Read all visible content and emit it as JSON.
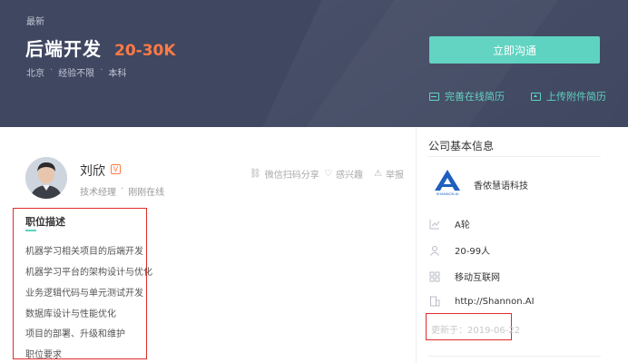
{
  "header": {
    "tag": "最新",
    "job_title": "后端开发",
    "salary": "20-30K",
    "meta": [
      "北京",
      "经验不限",
      "本科"
    ],
    "meta_sep": "·",
    "contact_button": "立即沟通",
    "online_resume": "完善在线简历",
    "upload_resume": "上传附件简历"
  },
  "recruiter": {
    "name": "刘欣",
    "badge": "V",
    "title": "技术经理",
    "sep": "·",
    "status": "刚刚在线"
  },
  "actions": {
    "share": "微信扫码分享",
    "favorite": "感兴趣",
    "report": "举报"
  },
  "job_description": {
    "title": "职位描述",
    "items": [
      "机器学习相关项目的后端开发",
      "机器学习平台的架构设计与优化",
      "业务逻辑代码与单元测试开发",
      "数据库设计与性能优化",
      "项目的部署、升级和维护",
      "职位要求"
    ]
  },
  "company": {
    "section_title": "公司基本信息",
    "logo_text": "SHANNON.AI",
    "name": "香侬慧语科技",
    "funding": "A轮",
    "size": "20-99人",
    "industry": "移动互联网",
    "website": "http://Shannon.AI",
    "updated": "更新于：2019-06-22"
  },
  "colors": {
    "header_bg": "#3f4761",
    "accent": "#5ed3c1",
    "salary": "#ff7a45",
    "highlight_box": "#e22b2b",
    "logo_blue": "#1f5fbf"
  }
}
